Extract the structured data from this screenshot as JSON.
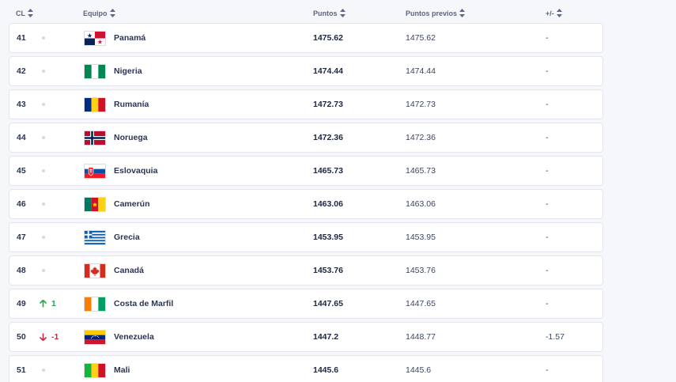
{
  "header": {
    "rank_label": "CL",
    "team_label": "Equipo",
    "points_label": "Puntos",
    "prev_points_label": "Puntos previos",
    "diff_label": "+/-"
  },
  "colors": {
    "trend_up": "#2f9e4d",
    "trend_down": "#d6263a",
    "row_background": "#ffffff",
    "page_background": "#f6f7fb"
  },
  "rows": [
    {
      "rank": "41",
      "trend": "none",
      "trend_value": "",
      "team": "Panamá",
      "flag": "panama-flag",
      "points": "1475.62",
      "prev_points": "1475.62",
      "diff": "-"
    },
    {
      "rank": "42",
      "trend": "none",
      "trend_value": "",
      "team": "Nigeria",
      "flag": "nigeria-flag",
      "points": "1474.44",
      "prev_points": "1474.44",
      "diff": "-"
    },
    {
      "rank": "43",
      "trend": "none",
      "trend_value": "",
      "team": "Rumanía",
      "flag": "romania-flag",
      "points": "1472.73",
      "prev_points": "1472.73",
      "diff": "-"
    },
    {
      "rank": "44",
      "trend": "none",
      "trend_value": "",
      "team": "Noruega",
      "flag": "norway-flag",
      "points": "1472.36",
      "prev_points": "1472.36",
      "diff": "-"
    },
    {
      "rank": "45",
      "trend": "none",
      "trend_value": "",
      "team": "Eslovaquia",
      "flag": "slovakia-flag",
      "points": "1465.73",
      "prev_points": "1465.73",
      "diff": "-"
    },
    {
      "rank": "46",
      "trend": "none",
      "trend_value": "",
      "team": "Camerún",
      "flag": "cameroon-flag",
      "points": "1463.06",
      "prev_points": "1463.06",
      "diff": "-"
    },
    {
      "rank": "47",
      "trend": "none",
      "trend_value": "",
      "team": "Grecia",
      "flag": "greece-flag",
      "points": "1453.95",
      "prev_points": "1453.95",
      "diff": "-"
    },
    {
      "rank": "48",
      "trend": "none",
      "trend_value": "",
      "team": "Canadá",
      "flag": "canada-flag",
      "points": "1453.76",
      "prev_points": "1453.76",
      "diff": "-"
    },
    {
      "rank": "49",
      "trend": "up",
      "trend_value": "1",
      "team": "Costa de Marfil",
      "flag": "ivory-coast-flag",
      "points": "1447.65",
      "prev_points": "1447.65",
      "diff": "-"
    },
    {
      "rank": "50",
      "trend": "down",
      "trend_value": "-1",
      "team": "Venezuela",
      "flag": "venezuela-flag",
      "points": "1447.2",
      "prev_points": "1448.77",
      "diff": "-1.57"
    },
    {
      "rank": "51",
      "trend": "none",
      "trend_value": "",
      "team": "Mali",
      "flag": "mali-flag",
      "points": "1445.6",
      "prev_points": "1445.6",
      "diff": "-"
    }
  ]
}
